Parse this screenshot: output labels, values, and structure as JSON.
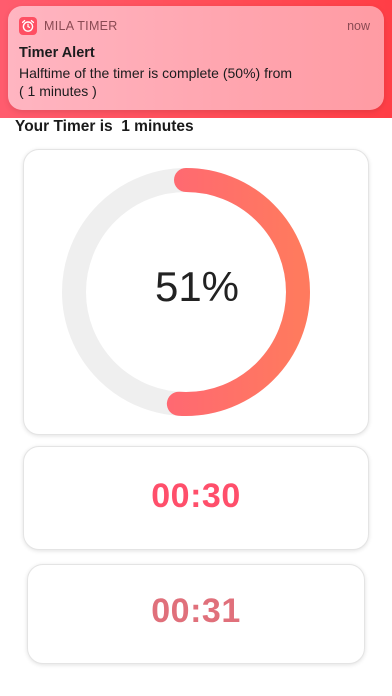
{
  "colors": {
    "header_band": "#ff4d57",
    "ring_track": "#efefef",
    "ring_gradient_start": "#ff5c80",
    "ring_gradient_end": "#ff7a5e",
    "elapsed_time": "#ff4f6b",
    "secondary_time": "#e0707b"
  },
  "notification": {
    "app_icon": "alarm-clock-icon",
    "app_name": "MILA TIMER",
    "time": "now",
    "title": "Timer Alert",
    "body_line1": "Halftime of the timer is complete (50%) from",
    "body_line2": "( 1 minutes )"
  },
  "timer": {
    "heading": "Your Timer is  1 minutes",
    "progress_percent": 51,
    "progress_label": "51%",
    "time_primary": "00:30",
    "time_secondary": "00:31"
  }
}
